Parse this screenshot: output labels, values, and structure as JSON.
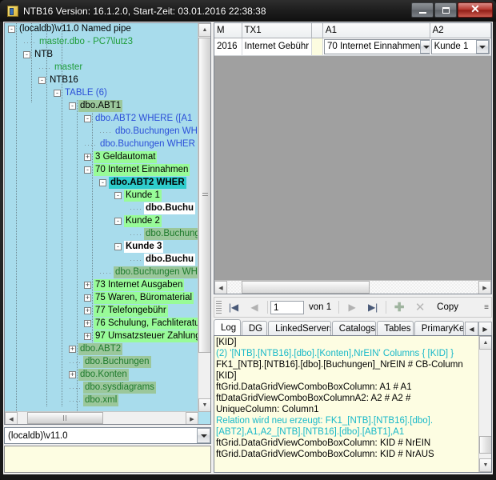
{
  "window": {
    "title": "NTB16  Version: 16.1.2.0, Start-Zeit: 03.01.2016 22:38:38",
    "icon": "app-icon",
    "minimize_label": "–",
    "maximize_label": "□",
    "close_label": "✕"
  },
  "tree": {
    "nodes": [
      {
        "indent": 0,
        "expander": "-",
        "label": "(localdb)\\v11.0 Named pipe",
        "color": "black",
        "hl": "none"
      },
      {
        "indent": 1,
        "expander": "",
        "label": "master.dbo - PC7\\lutz3",
        "color": "green",
        "hl": "none"
      },
      {
        "indent": 1,
        "expander": "-",
        "label": "NTB",
        "color": "black",
        "hl": "none"
      },
      {
        "indent": 2,
        "expander": "",
        "label": "master",
        "color": "green",
        "hl": "none"
      },
      {
        "indent": 2,
        "expander": "-",
        "label": "NTB16",
        "color": "black",
        "hl": "none"
      },
      {
        "indent": 3,
        "expander": "-",
        "label": "TABLE (6)",
        "color": "blue",
        "hl": "none"
      },
      {
        "indent": 4,
        "expander": "-",
        "label": "dbo.ABT1",
        "color": "black",
        "hl": "soft"
      },
      {
        "indent": 5,
        "expander": "-",
        "label": "dbo.ABT2  WHERE ([A1",
        "color": "blue",
        "hl": "none"
      },
      {
        "indent": 6,
        "expander": "",
        "label": "dbo.Buchungen  WH",
        "color": "blue",
        "hl": "none"
      },
      {
        "indent": 5,
        "expander": "",
        "label": "dbo.Buchungen  WHER",
        "color": "blue",
        "hl": "none"
      },
      {
        "indent": 5,
        "expander": "+",
        "label": "3 Geldautomat",
        "color": "black",
        "hl": "bright"
      },
      {
        "indent": 5,
        "expander": "-",
        "label": "70 Internet Einnahmen",
        "color": "black",
        "hl": "bright"
      },
      {
        "indent": 6,
        "expander": "-",
        "label": "dbo.ABT2  WHER",
        "color": "black",
        "hl": "teal",
        "bold": true
      },
      {
        "indent": 7,
        "expander": "-",
        "label": "Kunde 1",
        "color": "black",
        "hl": "bright"
      },
      {
        "indent": 8,
        "expander": "",
        "label": "dbo.Buchu",
        "color": "black",
        "hl": "white",
        "bold": true
      },
      {
        "indent": 7,
        "expander": "-",
        "label": "Kunde 2",
        "color": "black",
        "hl": "bright"
      },
      {
        "indent": 8,
        "expander": "",
        "label": "dbo.Buchung",
        "color": "dgreen",
        "hl": "soft"
      },
      {
        "indent": 7,
        "expander": "-",
        "label": "Kunde 3",
        "color": "black",
        "hl": "white",
        "bold": true
      },
      {
        "indent": 8,
        "expander": "",
        "label": "dbo.Buchu",
        "color": "black",
        "hl": "white",
        "bold": true
      },
      {
        "indent": 6,
        "expander": "",
        "label": "dbo.Buchungen  WH",
        "color": "dgreen",
        "hl": "soft"
      },
      {
        "indent": 5,
        "expander": "+",
        "label": "73 Internet Ausgaben",
        "color": "black",
        "hl": "bright"
      },
      {
        "indent": 5,
        "expander": "+",
        "label": "75 Waren, Büromaterial",
        "color": "black",
        "hl": "bright"
      },
      {
        "indent": 5,
        "expander": "+",
        "label": "77 Telefongebühr",
        "color": "black",
        "hl": "bright"
      },
      {
        "indent": 5,
        "expander": "+",
        "label": "76 Schulung, Fachliteratu",
        "color": "black",
        "hl": "bright"
      },
      {
        "indent": 5,
        "expander": "+",
        "label": "97 Umsatzsteuer Zahlung",
        "color": "black",
        "hl": "bright"
      },
      {
        "indent": 4,
        "expander": "+",
        "label": "dbo.ABT2",
        "color": "dgreen",
        "hl": "soft"
      },
      {
        "indent": 4,
        "expander": "",
        "label": "dbo.Buchungen",
        "color": "dgreen",
        "hl": "soft"
      },
      {
        "indent": 4,
        "expander": "+",
        "label": "dbo.Konten",
        "color": "dgreen",
        "hl": "soft"
      },
      {
        "indent": 4,
        "expander": "",
        "label": "dbo.sysdiagrams",
        "color": "dgreen",
        "hl": "soft"
      },
      {
        "indent": 4,
        "expander": "",
        "label": "dbo.xml",
        "color": "dgreen",
        "hl": "soft"
      }
    ],
    "scroll_up_icon": "▲",
    "scroll_down_icon": "▼",
    "scroll_left_icon": "◀",
    "scroll_right_icon": "▶"
  },
  "server_combo": {
    "value": "(localdb)\\v11.0",
    "dropdown_icon": "chevron-down"
  },
  "grid": {
    "columns": [
      "M",
      "TX1",
      "A1",
      "A2"
    ],
    "rows": [
      {
        "M": "2016",
        "TX1": "Internet Gebühr",
        "A1": "70 Internet Einnahmen",
        "A2": "Kunde 1"
      }
    ],
    "scroll_left_icon": "◀",
    "scroll_right_icon": "▶"
  },
  "navigator": {
    "first_icon": "|◀",
    "prev_icon": "◀",
    "position": "1",
    "of_label": "von 1",
    "next_icon": "▶",
    "last_icon": "▶|",
    "add_icon": "✚",
    "delete_icon": "✕",
    "copy_label": "Copy",
    "overflow_icon": "≡"
  },
  "tabs": {
    "items": [
      {
        "label": "Log",
        "active": true
      },
      {
        "label": "DG",
        "active": false
      },
      {
        "label": "LinkedServers",
        "active": false
      },
      {
        "label": "Catalogs",
        "active": false
      },
      {
        "label": "Tables",
        "active": false
      },
      {
        "label": "PrimaryKe",
        "active": false
      }
    ],
    "scroll_left_icon": "◀",
    "scroll_right_icon": "▶"
  },
  "log": {
    "lines": [
      {
        "text": "[KID]",
        "color": "black"
      },
      {
        "text": "(2) '[NTB].[NTB16].[dbo].[Konten],NrEIN' Columns { [KID] }",
        "color": "cyan"
      },
      {
        "text": "FK1_[NTB].[NTB16].[dbo].[Buchungen]_NrEIN # CB-Column",
        "color": "black"
      },
      {
        "text": "[KID]",
        "color": "black"
      },
      {
        "text": "ftGrid.DataGridViewComboBoxColumn: A1 # A1",
        "color": "black"
      },
      {
        "text": "ftDataGridViewComboBoxColumnA2: A2 # A2 # UniqueColumn: Column1",
        "color": "black"
      },
      {
        "text": "Relation wird neu erzeugt: FK1_[NTB].[NTB16].[dbo].[ABT2],A1,A2_[NTB].[NTB16].[dbo].[ABT1],A1",
        "color": "cyan"
      },
      {
        "text": "ftGrid.DataGridViewComboBoxColumn: KID # NrEIN",
        "color": "black"
      },
      {
        "text": "ftGrid.DataGridViewComboBoxColumn: KID # NrAUS",
        "color": "black"
      }
    ]
  },
  "colors": {
    "tree_background": "#a8dcec",
    "highlight_soft": "#9bc79b",
    "highlight_bright": "#98fb98",
    "highlight_teal": "#2ecccc",
    "grid_empty": "#a0a0a0",
    "log_background": "#fdfde2",
    "log_cyan": "#17b8c8",
    "node_blue": "#2b4fd8",
    "node_green": "#1f9d3a"
  }
}
